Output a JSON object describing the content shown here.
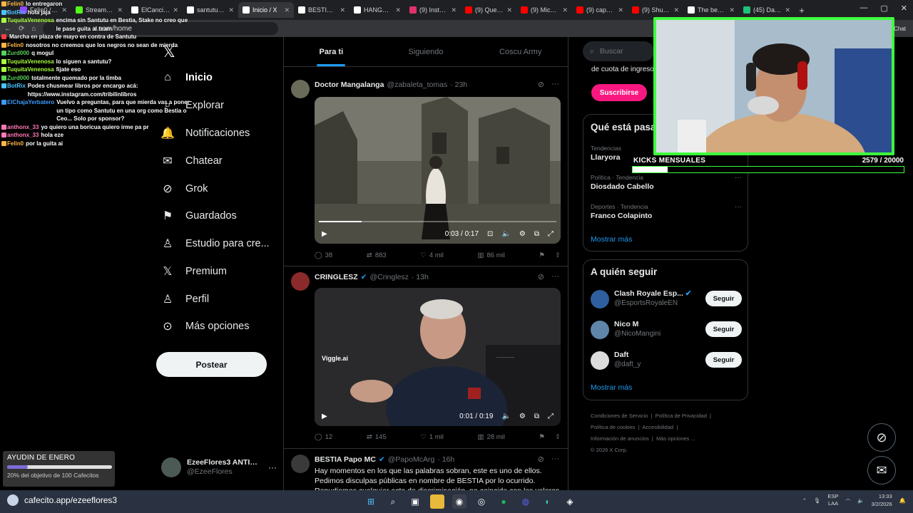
{
  "browser": {
    "tabs": [
      {
        "label": "Felin0 / BotRix",
        "icon": "twitch-icon",
        "color": "#9147ff"
      },
      {
        "label": "Stream - Kick",
        "icon": "kick-icon",
        "color": "#53fc18"
      },
      {
        "label": "ElCanciller",
        "icon": "x-icon",
        "color": "#ffffff"
      },
      {
        "label": "santutu - X",
        "icon": "x-icon",
        "color": "#ffffff"
      },
      {
        "label": "Inicio / X",
        "icon": "x-icon",
        "color": "#ffffff"
      },
      {
        "label": "BESTIA (@",
        "icon": "x-icon",
        "color": "#ffffff"
      },
      {
        "label": "HANGE ZO",
        "icon": "x-icon",
        "color": "#ffffff"
      },
      {
        "label": "(9) Instagra",
        "icon": "instagram-icon",
        "color": "#e1306c"
      },
      {
        "label": "(9) Queen",
        "icon": "youtube-icon",
        "color": "#ff0000"
      },
      {
        "label": "(9) Michael",
        "icon": "youtube-icon",
        "color": "#ff0000"
      },
      {
        "label": "(9) capcom",
        "icon": "youtube-icon",
        "color": "#ff0000"
      },
      {
        "label": "(9) Shutter",
        "icon": "youtube-icon",
        "color": "#ff0000"
      },
      {
        "label": "The best C",
        "icon": "web-icon",
        "color": "#ffffff"
      },
      {
        "label": "(45) Dashb",
        "icon": "dashboard-icon",
        "color": "#1fc17b"
      }
    ],
    "url": "x.com/home"
  },
  "chat": [
    {
      "user": "Felin0",
      "color": "#ffb547",
      "msg": "lo entregaron"
    },
    {
      "user": "BotRix",
      "color": "#4cc2ff",
      "msg": "hola jaja"
    },
    {
      "user": "TuquitaVenenosa",
      "color": "#a8ff3e",
      "msg": "encima sin Santutu en Bestia, Stake no creo que le pase guita al team"
    },
    {
      "user": "",
      "color": "#ff3e3e",
      "msg": "Marcha en plaza de mayo en contra de Santutu"
    },
    {
      "user": "Felin0",
      "color": "#ffb547",
      "msg": "nosotros no creemos que los negros no sean de mierda"
    },
    {
      "user": "Zurd000",
      "color": "#57d05a",
      "msg": "q mogul"
    },
    {
      "user": "TuquitaVenenosa",
      "color": "#a8ff3e",
      "msg": "lo siguen a santutu?"
    },
    {
      "user": "TuquitaVenenosa",
      "color": "#a8ff3e",
      "msg": "fijate eso"
    },
    {
      "user": "Zurd000",
      "color": "#57d05a",
      "msg": "totalmente quemado por la timba"
    },
    {
      "user": "BotRix",
      "color": "#4cc2ff",
      "msg": "Podes chusmear libros por encargo acá: https://www.instagram.com/tribilinlibros"
    },
    {
      "user": "ElChajaYerbatero",
      "color": "#3e9bff",
      "msg": "Vuelvo a preguntas, para que mierda vas a poner un tipo como Santutu en una org como Bestia o Ceo... Solo por sponsor?"
    },
    {
      "user": "anthonx_33",
      "color": "#ff7ab6",
      "msg": "yo quiero una boricua quiero irme pa pr"
    },
    {
      "user": "anthonx_33",
      "color": "#ff7ab6",
      "msg": "hola eze"
    },
    {
      "user": "Felin0",
      "color": "#ffb547",
      "msg": "por la guita ai"
    }
  ],
  "nav": {
    "items": [
      {
        "label": "Inicio",
        "icon": "home-icon"
      },
      {
        "label": "Explorar",
        "icon": "search-icon"
      },
      {
        "label": "Notificaciones",
        "icon": "bell-icon"
      },
      {
        "label": "Chatear",
        "icon": "mail-icon"
      },
      {
        "label": "Grok",
        "icon": "grok-icon"
      },
      {
        "label": "Guardados",
        "icon": "bookmark-icon"
      },
      {
        "label": "Estudio para cre...",
        "icon": "studio-icon"
      },
      {
        "label": "Premium",
        "icon": "x-icon"
      },
      {
        "label": "Perfil",
        "icon": "person-icon"
      },
      {
        "label": "Más opciones",
        "icon": "more-circle-icon"
      }
    ],
    "post_label": "Postear",
    "profile_name": "EzeeFlores3 ANTIE...",
    "profile_handle": "@EzeeFlores"
  },
  "feed": {
    "tabs": [
      "Para ti",
      "Siguiendo",
      "Coscu Army"
    ],
    "tweets": [
      {
        "name": "Doctor Mangalanga",
        "handle": "@zabaleta_tomas",
        "time": "· 23h",
        "video_time": "0:03 / 0:17",
        "progress": 0.18,
        "replies": "38",
        "reposts": "883",
        "likes": "4 mil",
        "views": "86 mil"
      },
      {
        "name": "CRINGLESZ",
        "handle": "@Cringlesz",
        "time": "· 13h",
        "video_time": "0:01 / 0:19",
        "watermark": "Viggle.ai",
        "replies": "12",
        "reposts": "145",
        "likes": "1 mil",
        "views": "28 mil"
      },
      {
        "name": "BESTIA Papo MC",
        "handle": "@PapoMcArg",
        "time": "· 16h",
        "text": "Hay momentos en los que las palabras sobran, este es uno de ellos. Pedimos disculpas públicas en nombre de BESTIA por lo ocurrido. Repudiamos cualquier acto de discriminación, no coincide con los valores"
      }
    ]
  },
  "right": {
    "search_placeholder": "Buscar",
    "premium_text": "de cuota de ingreso",
    "subscribe_label": "Suscribirse",
    "trends_title": "Qué está pasa",
    "trends": [
      {
        "category": "Tendencias",
        "name": "Llaryora"
      },
      {
        "category": "Política · Tendencia",
        "name": "Diosdado Cabello"
      },
      {
        "category": "Deportes · Tendencia",
        "name": "Franco Colapinto"
      }
    ],
    "show_more": "Mostrar más",
    "follow_title": "A quién seguir",
    "follow": [
      {
        "name": "Clash Royale Esp...",
        "handle": "@EsportsRoyaleEN",
        "verified": true
      },
      {
        "name": "Nico M",
        "handle": "@NicoMangini",
        "verified": false
      },
      {
        "name": "Daft",
        "handle": "@daft_y",
        "verified": false
      }
    ],
    "follow_label": "Seguir",
    "footer": [
      "Condiciones de Servicio",
      "Política de Privacidad",
      "Política de cookies",
      "Accesibilidad",
      "Información de anuncios",
      "Más opciones ...",
      "© 2026 X Corp."
    ]
  },
  "stream": {
    "kicks_label": "KICKS MENSUALES",
    "kicks_count": "2579  / 20000",
    "kicks_progress": 0.129,
    "chat_label": "Chat",
    "goal_title": "AYUDIN DE ENERO",
    "goal_caption": "20% del objetivo de 100 Cafecitos",
    "goal_progress": 0.2
  },
  "taskbar": {
    "app_label": "cafecito.app/ezeeflores3",
    "lang": "ESP",
    "lang_sub": "LAA",
    "time": "13:33",
    "date": "3/2/2026"
  }
}
